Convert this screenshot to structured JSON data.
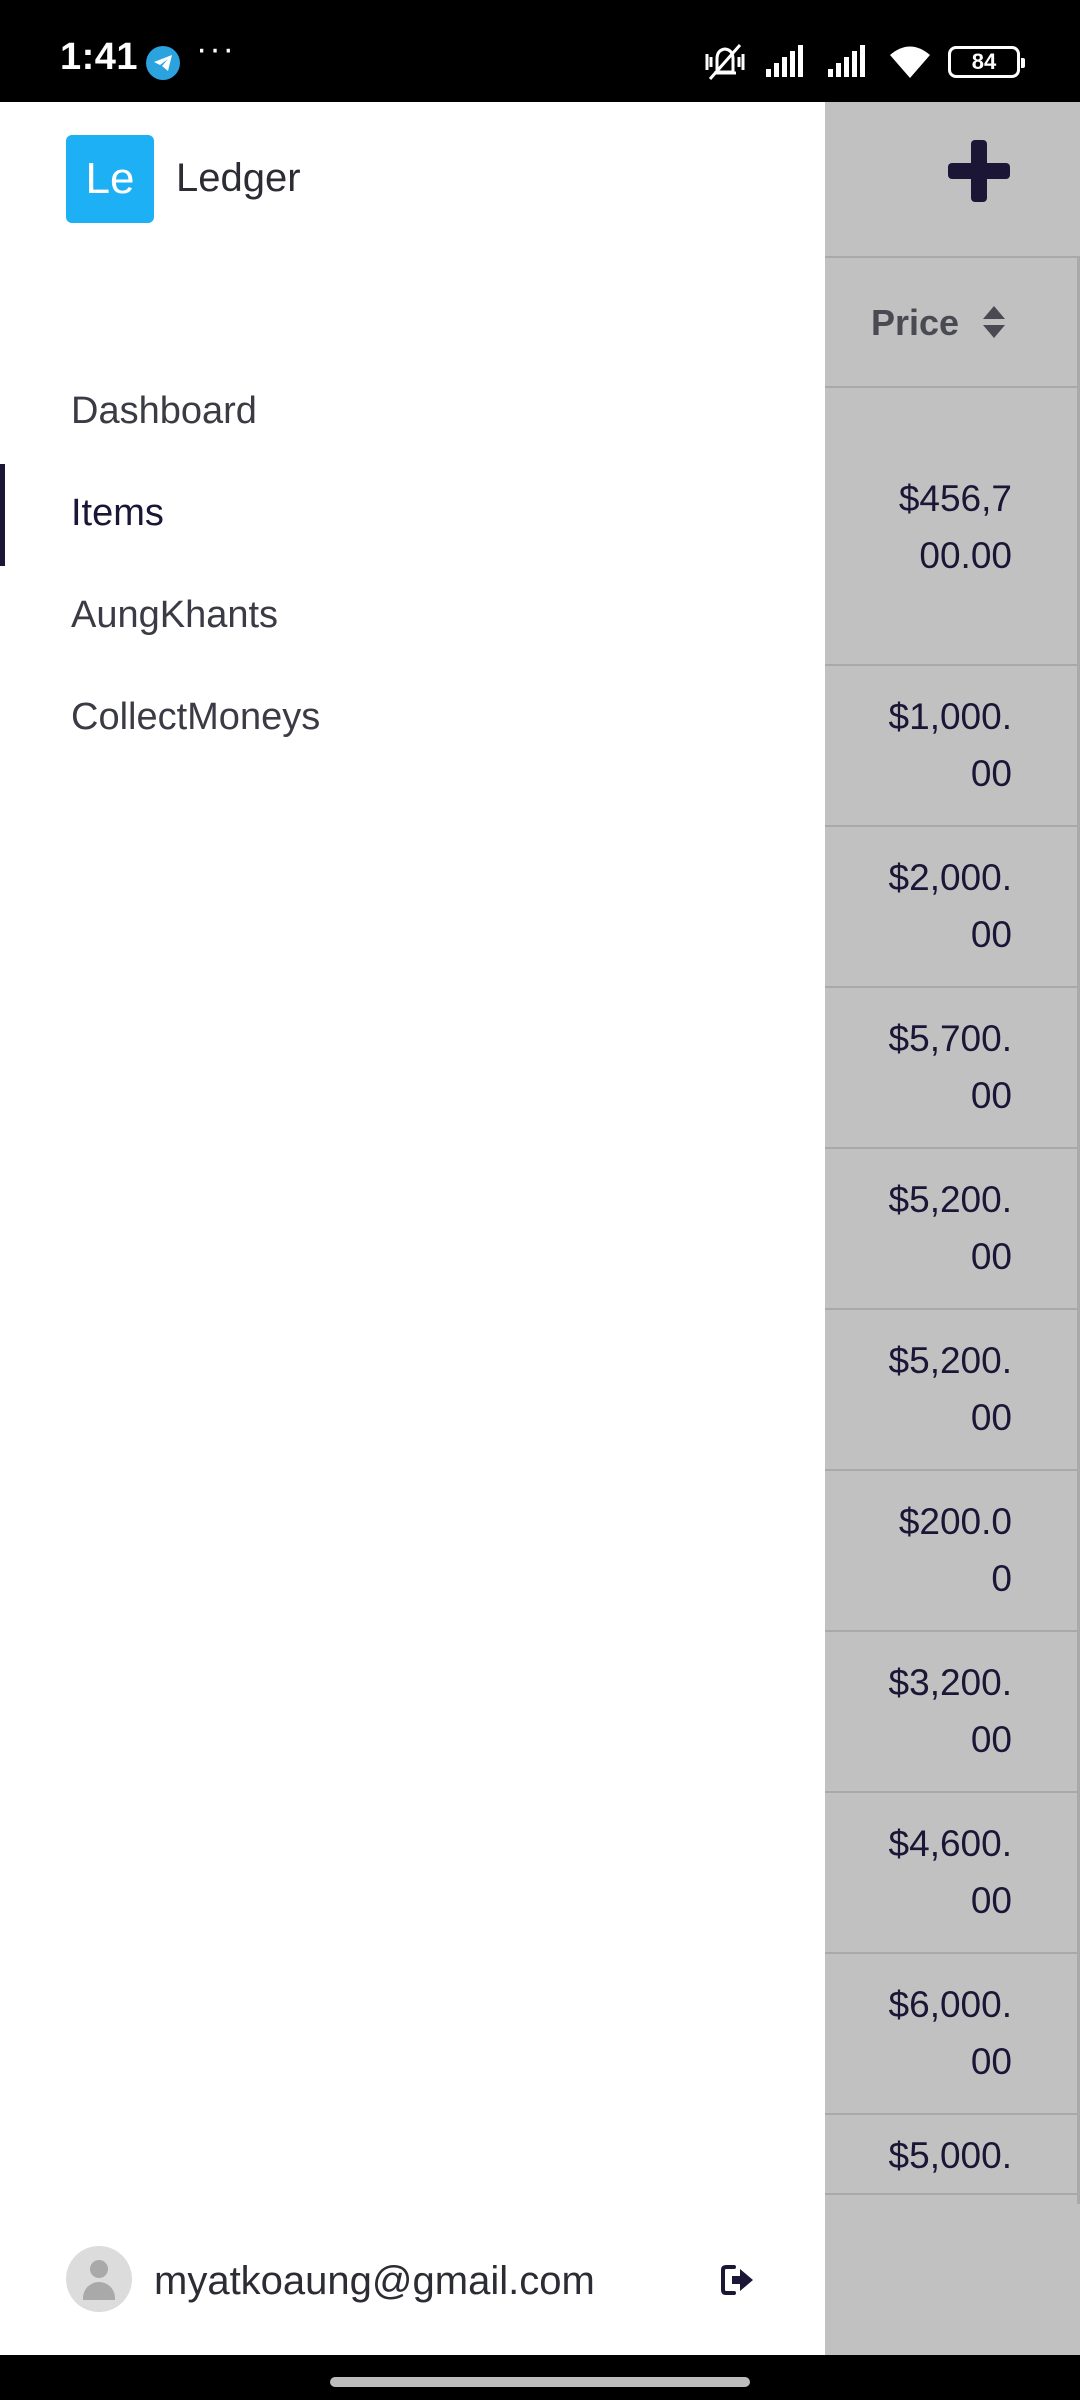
{
  "status_bar": {
    "time": "1:41",
    "more": "···",
    "battery": "84",
    "icons": [
      "telegram-icon",
      "mute-vibrate-icon",
      "signal-icon",
      "wifi-icon",
      "battery-icon"
    ]
  },
  "drawer": {
    "logo_text": "Le",
    "app_name": "Ledger",
    "nav_items": [
      {
        "label": "Dashboard",
        "active": false
      },
      {
        "label": "Items",
        "active": true
      },
      {
        "label": "AungKhants",
        "active": false
      },
      {
        "label": "CollectMoneys",
        "active": false
      }
    ],
    "user_email": "myatkoaung@gmail.com"
  },
  "table": {
    "price_header": "Price",
    "prices": [
      "$456,7\n00.00",
      "$1,000.\n00",
      "$2,000.\n00",
      "$5,700.\n00",
      "$5,200.\n00",
      "$5,200.\n00",
      "$200.0\n0",
      "$3,200.\n00",
      "$4,600.\n00",
      "$6,000.\n00",
      "$5,000."
    ]
  },
  "colors": {
    "accent": "#1eb0f5",
    "primary_dark": "#1b1636",
    "overlay_bg": "#c1c1c1"
  }
}
